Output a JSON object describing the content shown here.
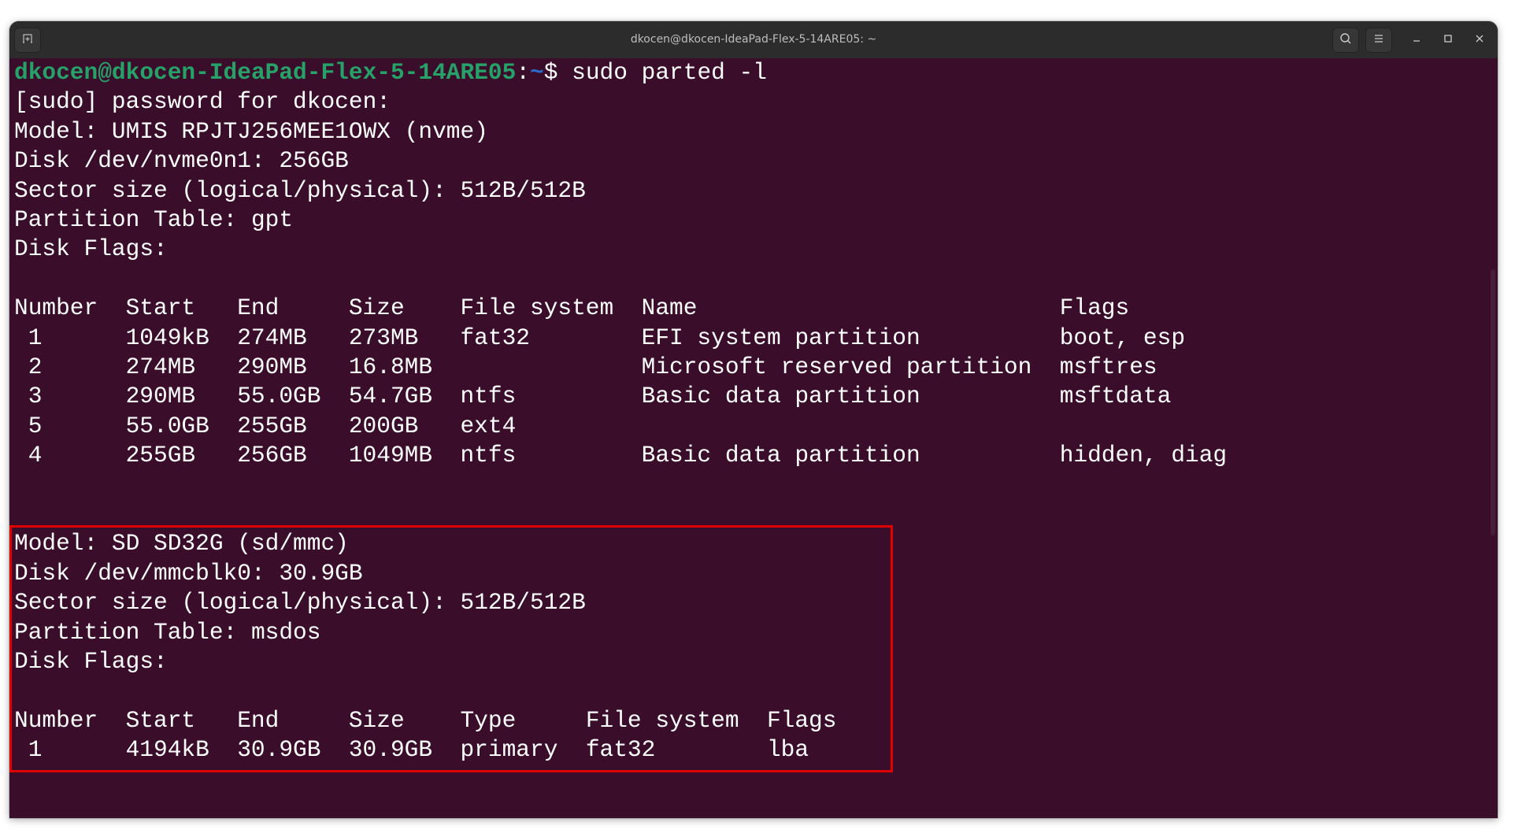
{
  "window": {
    "title": "dkocen@dkocen-IdeaPad-Flex-5-14ARE05: ~",
    "buttons": {
      "new_tab_icon": "new-tab-icon",
      "search_icon": "search-icon",
      "menu_icon": "hamburger-menu-icon",
      "minimize_icon": "minimize-icon",
      "maximize_icon": "maximize-icon",
      "close_icon": "close-icon"
    }
  },
  "colors": {
    "terminal_bg": "#3a0d2b",
    "titlebar_bg": "#2c2c2c",
    "prompt_user": "#26a269",
    "prompt_path": "#2a6cc7",
    "text": "#ffffff",
    "highlight_border": "#e00000"
  },
  "prompt": {
    "user_host": "dkocen@dkocen-IdeaPad-Flex-5-14ARE05",
    "colon": ":",
    "path": "~",
    "symbol": "$ ",
    "command": "sudo parted -l"
  },
  "sudo_prompt": "[sudo] password for dkocen:",
  "disks": [
    {
      "model": "Model: UMIS RPJTJ256MEE1OWX (nvme)",
      "disk": "Disk /dev/nvme0n1: 256GB",
      "sector_size": "Sector size (logical/physical): 512B/512B",
      "partition_table": "Partition Table: gpt",
      "disk_flags": "Disk Flags:",
      "columns": [
        "Number",
        "Start",
        "End",
        "Size",
        "File system",
        "Name",
        "Flags"
      ],
      "rows": [
        {
          "number": "1",
          "start": "1049kB",
          "end": "274MB",
          "size": "273MB",
          "fs": "fat32",
          "name": "EFI system partition",
          "flags": "boot, esp"
        },
        {
          "number": "2",
          "start": "274MB",
          "end": "290MB",
          "size": "16.8MB",
          "fs": "",
          "name": "Microsoft reserved partition",
          "flags": "msftres"
        },
        {
          "number": "3",
          "start": "290MB",
          "end": "55.0GB",
          "size": "54.7GB",
          "fs": "ntfs",
          "name": "Basic data partition",
          "flags": "msftdata"
        },
        {
          "number": "5",
          "start": "55.0GB",
          "end": "255GB",
          "size": "200GB",
          "fs": "ext4",
          "name": "",
          "flags": ""
        },
        {
          "number": "4",
          "start": "255GB",
          "end": "256GB",
          "size": "1049MB",
          "fs": "ntfs",
          "name": "Basic data partition",
          "flags": "hidden, diag"
        }
      ]
    },
    {
      "model": "Model: SD SD32G (sd/mmc)",
      "disk": "Disk /dev/mmcblk0: 30.9GB",
      "sector_size": "Sector size (logical/physical): 512B/512B",
      "partition_table": "Partition Table: msdos",
      "disk_flags": "Disk Flags:",
      "columns": [
        "Number",
        "Start",
        "End",
        "Size",
        "Type",
        "File system",
        "Flags"
      ],
      "rows": [
        {
          "number": "1",
          "start": "4194kB",
          "end": "30.9GB",
          "size": "30.9GB",
          "type": "primary",
          "fs": "fat32",
          "flags": "lba"
        }
      ]
    }
  ]
}
